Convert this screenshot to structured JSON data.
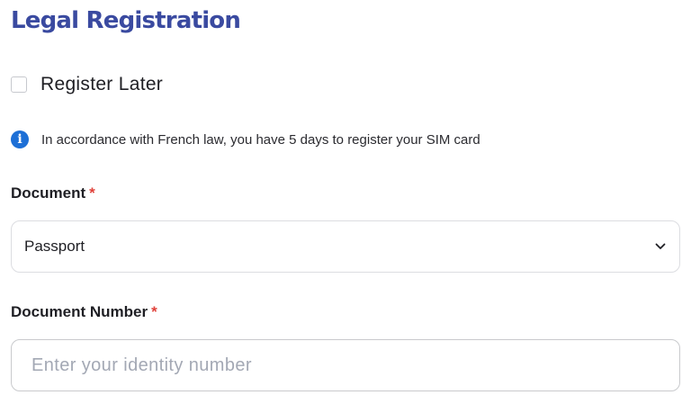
{
  "header": {
    "title": "Legal Registration"
  },
  "register_later": {
    "label": "Register Later",
    "checked": false
  },
  "notice": {
    "icon": "info-icon",
    "text": "In accordance with French law, you have 5 days to register your SIM card"
  },
  "document": {
    "label": "Document",
    "required_mark": "*",
    "selected": "Passport"
  },
  "document_number": {
    "label": "Document Number",
    "required_mark": "*",
    "value": "",
    "placeholder": "Enter your identity number"
  },
  "colors": {
    "title": "#3a4aa0",
    "info_icon": "#1d6fd6",
    "required": "#e0413a"
  }
}
